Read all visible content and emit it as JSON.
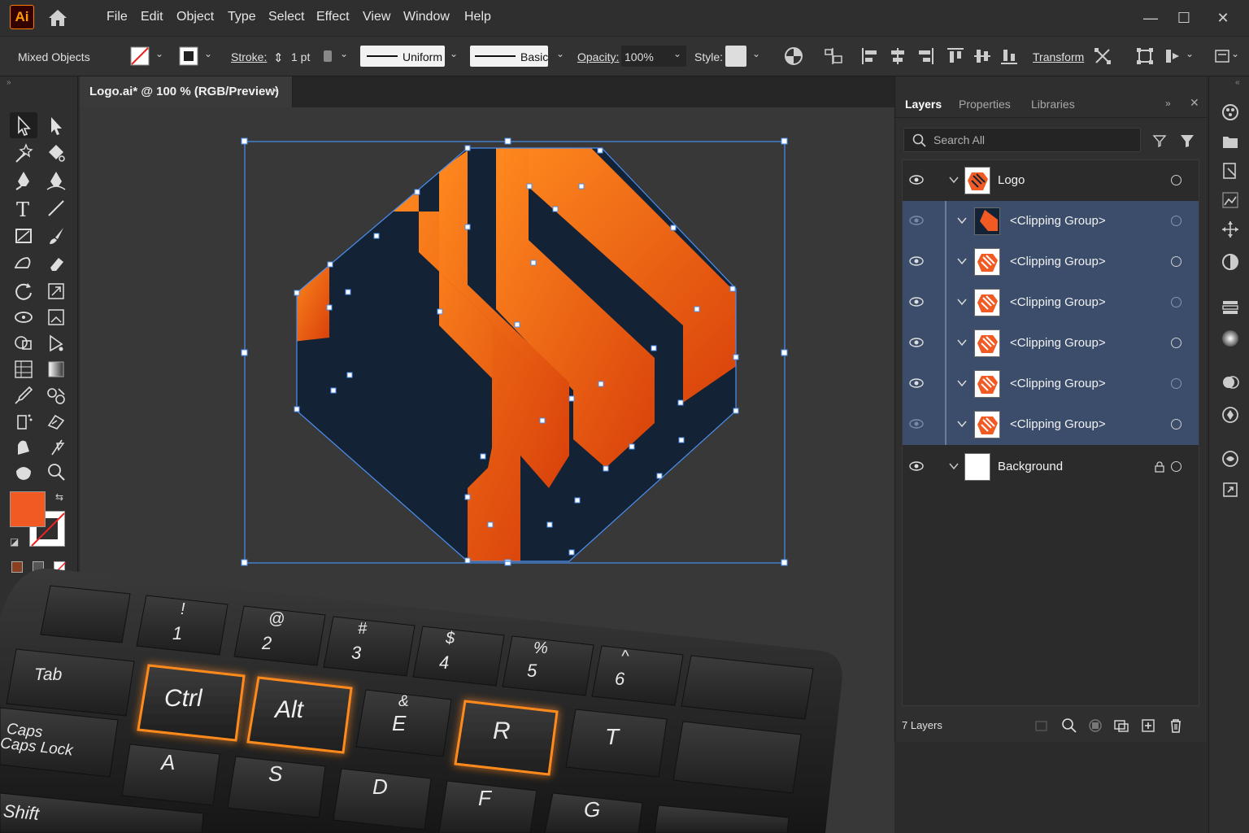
{
  "app": {
    "logo": "Ai",
    "home_icon": "home-icon"
  },
  "menu": [
    "File",
    "Edit",
    "Object",
    "Type",
    "Select",
    "Effect",
    "View",
    "Window",
    "Help"
  ],
  "window_controls": {
    "minimize": "—",
    "maximize": "☐",
    "close": "✕"
  },
  "control_bar": {
    "selection_type": "Mixed Objects",
    "stroke_label": "Stroke:",
    "stroke_weight": "1 pt",
    "profile_uniform": "Uniform",
    "brush_basic": "Basic",
    "opacity_label": "Opacity:",
    "opacity_value": "100%",
    "style_label": "Style:",
    "transform_label": "Transform"
  },
  "document_tab": {
    "title": "Logo.ai* @ 100 % (RGB/Preview)",
    "close": "×"
  },
  "colors": {
    "fill": "#f15a22",
    "accent_orange": "#ff7a1a",
    "navy": "#142236",
    "selection_blue": "#4a8ff0",
    "layer_selected": "#3b4d6b"
  },
  "layers_panel": {
    "tabs": [
      "Layers",
      "Properties",
      "Libraries"
    ],
    "search_placeholder": "Search All",
    "layers": [
      {
        "name": "Logo",
        "level": 0,
        "selected": false
      },
      {
        "name": "<Clipping Group>",
        "level": 1,
        "selected": true
      },
      {
        "name": "<Clipping Group>",
        "level": 1,
        "selected": true
      },
      {
        "name": "<Clipping Group>",
        "level": 1,
        "selected": true
      },
      {
        "name": "<Clipping Group>",
        "level": 1,
        "selected": true
      },
      {
        "name": "<Clipping Group>",
        "level": 1,
        "selected": true
      },
      {
        "name": "<Clipping Group>",
        "level": 1,
        "selected": true
      },
      {
        "name": "Background",
        "level": 0,
        "selected": false
      }
    ],
    "layer_count": "7 Layers"
  },
  "keyboard": {
    "row1": [
      {
        "top": "",
        "bottom": ""
      },
      {
        "top": "!",
        "bottom": "1"
      },
      {
        "top": "@",
        "bottom": "2"
      },
      {
        "top": "#",
        "bottom": "3"
      },
      {
        "top": "$",
        "bottom": "4"
      },
      {
        "top": "%",
        "bottom": "5"
      },
      {
        "top": "^",
        "bottom": "6"
      }
    ],
    "tab": "Tab",
    "ctrl": "Ctrl",
    "alt": "Alt",
    "e_top": "&",
    "e": "E",
    "r": "R",
    "t": "T",
    "caps_1": "Caps",
    "caps_2": "Caps Lock",
    "a": "A",
    "s": "S",
    "d": "D",
    "f": "F",
    "g": "G",
    "shift": "Shift"
  }
}
